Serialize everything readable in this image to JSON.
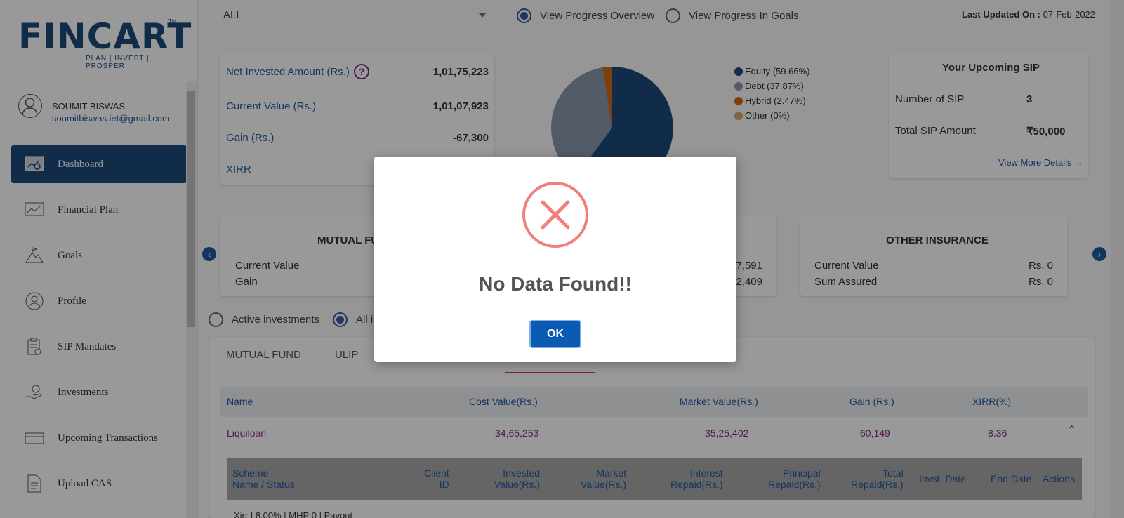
{
  "brand": {
    "name": "FINCART",
    "tagline": "PLAN | INVEST | PROSPER",
    "tm": "TM",
    "color": "#1b4a7a"
  },
  "user": {
    "name": "SOUMIT BISWAS",
    "email": "soumitbiswas.iet@gmail.com"
  },
  "sidebar": {
    "items": [
      {
        "label": "Dashboard",
        "icon": "dashboard-icon",
        "active": true
      },
      {
        "label": "Financial Plan",
        "icon": "chart-line-icon"
      },
      {
        "label": "Goals",
        "icon": "mountain-flag-icon"
      },
      {
        "label": "Profile",
        "icon": "user-circle-icon"
      },
      {
        "label": "SIP Mandates",
        "icon": "clipboard-icon"
      },
      {
        "label": "Investments",
        "icon": "hand-money-icon"
      },
      {
        "label": "Upcoming Transactions",
        "icon": "card-icon"
      },
      {
        "label": "Upload CAS",
        "icon": "document-icon"
      }
    ]
  },
  "filters": {
    "select_value": "ALL",
    "view_overview": "View Progress Overview",
    "view_goals": "View Progress In Goals",
    "last_updated_label": "Last Updated On :",
    "last_updated_value": "07-Feb-2022"
  },
  "summary": {
    "net_invested_label": "Net Invested Amount (Rs.)",
    "net_invested_value": "1,01,75,223",
    "current_value_label": "Current Value (Rs.)",
    "current_value_value": "1,01,07,923",
    "gain_label": "Gain (Rs.)",
    "gain_value": "-67,300",
    "xirr_label": "XIRR"
  },
  "allocation": {
    "legend": [
      {
        "label": "Equity (59.66%)",
        "color": "#1b4a7a",
        "value": 59.66
      },
      {
        "label": "Debt (37.87%)",
        "color": "#8a98ad",
        "value": 37.87
      },
      {
        "label": "Hybrid (2.47%)",
        "color": "#d06a17",
        "value": 2.47
      },
      {
        "label": "Other (0%)",
        "color": "#d9a46a",
        "value": 0
      }
    ]
  },
  "sip": {
    "title": "Your Upcoming SIP",
    "count_label": "Number of SIP",
    "count_value": "3",
    "amount_label": "Total SIP Amount",
    "amount_value": "₹50,000",
    "more_link": "View More Details →"
  },
  "cards": {
    "mf_title": "MUTUAL FU",
    "mf_current_label": "Current Value",
    "mf_gain_label": "Gain",
    "mid_val1": "7,591",
    "mid_val2": "2,409",
    "ins_title": "OTHER INSURANCE",
    "ins_current_label": "Current Value",
    "ins_current_value": "Rs. 0",
    "ins_sum_label": "Sum Assured",
    "ins_sum_value": "Rs. 0"
  },
  "toggles": {
    "active": "Active investments",
    "all": "All i"
  },
  "tabs": [
    "MUTUAL FUND",
    "ULIP"
  ],
  "table": {
    "headers": [
      "Name",
      "Cost Value(Rs.)",
      "Market Value(Rs.)",
      "Gain (Rs.)",
      "XIRR(%)"
    ],
    "row": {
      "name": "Liquiloan",
      "cost": "34,65,253",
      "market": "35,25,402",
      "gain": "60,149",
      "xirr": "8.36"
    },
    "sub_headers": [
      "Scheme\nName / Status",
      "Client\nID",
      "Invested\nValue(Rs.)",
      "Market\nValue(Rs.)",
      "Interest\nRepaid(Rs.)",
      "Principal\nRepaid(Rs.)",
      "Total\nRepaid(Rs.)",
      "Invst. Date",
      "End Date",
      "Actions"
    ],
    "sub_row": "Xirr | 8.00% | MHP:0 | Payout"
  },
  "modal": {
    "title": "No Data Found!!",
    "ok": "OK"
  }
}
